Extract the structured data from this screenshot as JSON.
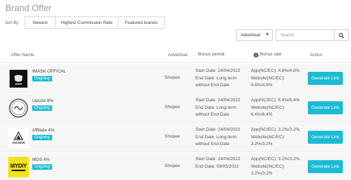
{
  "page": {
    "title": "Brand Offer"
  },
  "sort": {
    "label": "Sort By",
    "options": [
      "Newest",
      "Highest Commission Rate",
      "Featured brands"
    ]
  },
  "filters": {
    "advertiser_select": "Advertiser",
    "search_placeholder": "Search"
  },
  "table": {
    "columns": {
      "offer_name": "Offer Name",
      "advertiser": "Advertiser",
      "bonus_period": "Bonus period",
      "bonus_rate": "Bonus rate",
      "action": "Action"
    },
    "rows": [
      {
        "logo": "IMASK logo",
        "name": "IMASK OFFICAL",
        "status": "Ongoing",
        "advertiser": "Shopee",
        "start": "Start Date: 24/04/2022",
        "end": "End Date: Long term without End Date",
        "app_rate": "App(NC/EC): 4.8%/4.8%",
        "web_rate": "Website(NC/EC): 4.8%/4.8%",
        "action": "Generate Link"
      },
      {
        "logo": "Upsize logo",
        "name": "Upsize 8%",
        "status": "Ongoing",
        "advertiser": "Shopee",
        "start": "Start Date: 24/04/2022",
        "end": "End Date: Long term without End Date",
        "app_rate": "App(NC/EC): 6.4%/6.4%",
        "web_rate": "Website(NC/EC): 6.4%/6.4%",
        "action": "Generate Link"
      },
      {
        "logo": "AVLNAR logo",
        "logo_text": "AVLNAR",
        "name": "Affiliate 4%",
        "status": "Ongoing",
        "advertiser": "Shopee",
        "start": "Start Date: 24/04/2022",
        "end": "End Date: Long term without End Date",
        "app_rate": "App(NC/EC): 3.2%/3.2%",
        "web_rate": "Website(NC/EC): 3.2%/3.2%",
        "action": "Generate Link"
      },
      {
        "logo": "MYDIY logo",
        "logo_text": "MYDIY",
        "name": "MDS 4%",
        "status": "Ongoing",
        "advertiser": "Shopee",
        "start": "Start Date: 24/04/2022",
        "end": "End Date: 09/05/2022",
        "app_rate": "App(NC/EC): 3.2%/3.2%",
        "web_rate": "Website(NC/EC): 3.2%/3.2%",
        "action": "Generate Link"
      }
    ]
  },
  "colors": {
    "accent": "#19bcd3",
    "row_bg": "#f6f6f6"
  }
}
